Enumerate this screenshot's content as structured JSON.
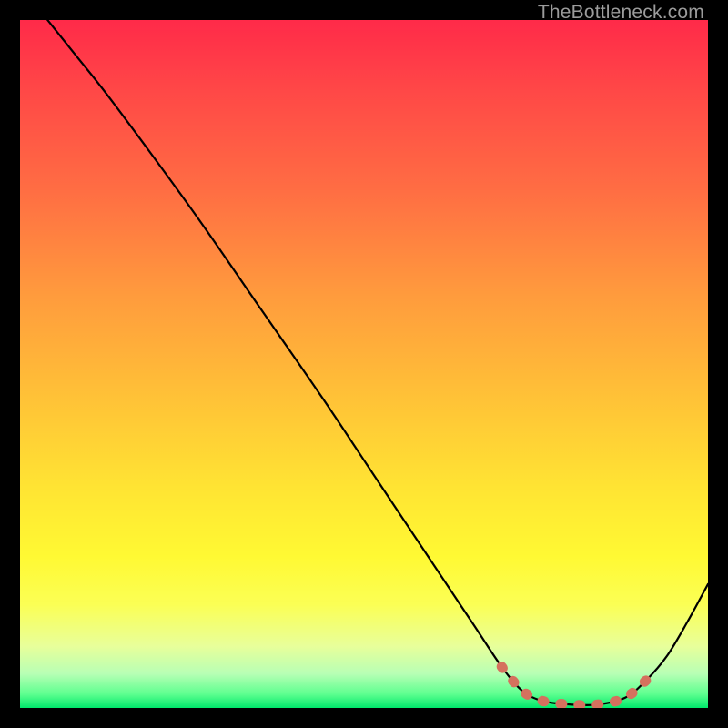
{
  "attribution": "TheBottleneck.com",
  "chart_data": {
    "type": "line",
    "title": "",
    "xlabel": "",
    "ylabel": "",
    "xlim": [
      0,
      100
    ],
    "ylim": [
      0,
      100
    ],
    "curve_points": [
      {
        "x": 4.0,
        "y": 100.0
      },
      {
        "x": 8.0,
        "y": 95.0
      },
      {
        "x": 12.0,
        "y": 90.0
      },
      {
        "x": 18.0,
        "y": 82.0
      },
      {
        "x": 26.0,
        "y": 71.0
      },
      {
        "x": 35.0,
        "y": 58.0
      },
      {
        "x": 44.0,
        "y": 45.0
      },
      {
        "x": 52.0,
        "y": 33.0
      },
      {
        "x": 60.0,
        "y": 21.0
      },
      {
        "x": 66.0,
        "y": 12.0
      },
      {
        "x": 70.0,
        "y": 6.0
      },
      {
        "x": 73.0,
        "y": 2.5
      },
      {
        "x": 76.0,
        "y": 1.0
      },
      {
        "x": 80.0,
        "y": 0.5
      },
      {
        "x": 84.0,
        "y": 0.5
      },
      {
        "x": 88.0,
        "y": 1.5
      },
      {
        "x": 91.0,
        "y": 4.0
      },
      {
        "x": 94.0,
        "y": 7.5
      },
      {
        "x": 97.0,
        "y": 12.5
      },
      {
        "x": 100.0,
        "y": 18.0
      }
    ],
    "highlight_segment": {
      "x_start": 70.0,
      "x_end": 90.0
    },
    "background_gradient": {
      "top": "#ff2a49",
      "bottom": "#00e86b"
    },
    "colors": {
      "curve": "#000000",
      "highlight": "#d5715e"
    }
  }
}
